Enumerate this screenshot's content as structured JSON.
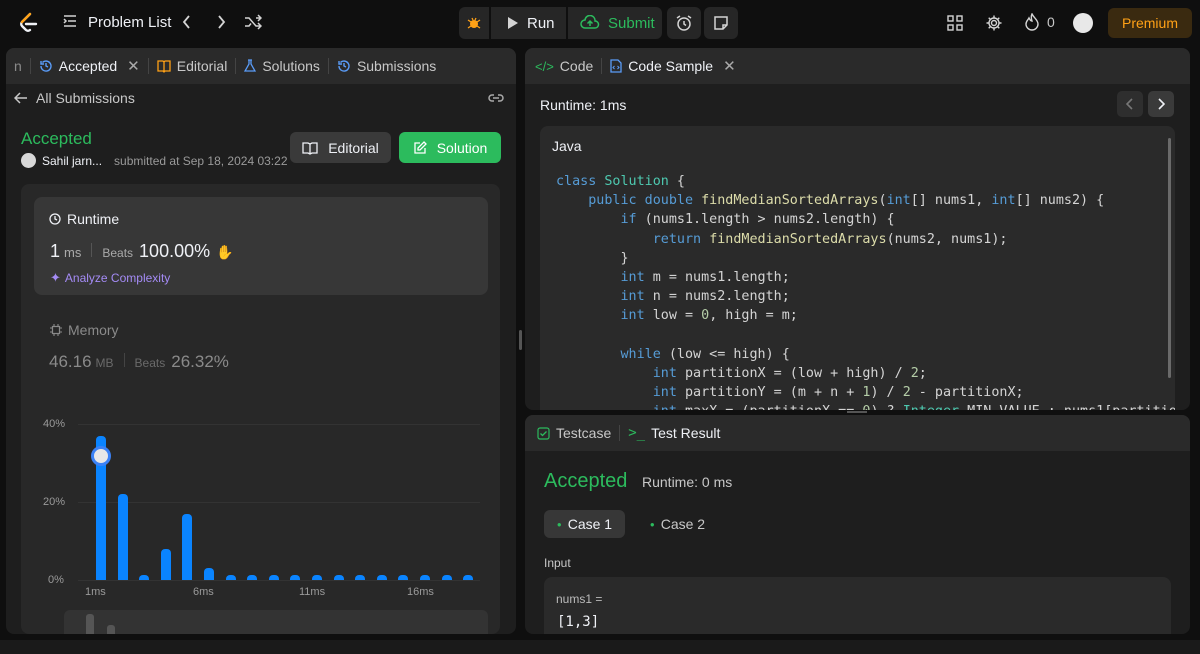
{
  "topbar": {
    "problem_list": "Problem List",
    "run": "Run",
    "submit": "Submit",
    "streak_count": "0",
    "premium": "Premium"
  },
  "left": {
    "tabs": [
      {
        "label": "n"
      },
      {
        "label": "Accepted"
      },
      {
        "label": "Editorial"
      },
      {
        "label": "Solutions"
      },
      {
        "label": "Submissions"
      }
    ],
    "all_submissions": "All Submissions",
    "status": "Accepted",
    "user": "Sahil jarn...",
    "submitted_at": "submitted at Sep 18, 2024 03:22",
    "editorial_btn": "Editorial",
    "solution_btn": "Solution",
    "runtime": {
      "title": "Runtime",
      "value": "1",
      "unit": "ms",
      "beats_label": "Beats",
      "beats": "100.00%",
      "analyze": "Analyze Complexity"
    },
    "memory": {
      "title": "Memory",
      "value": "46.16",
      "unit": "MB",
      "beats_label": "Beats",
      "beats": "26.32%"
    }
  },
  "chart_data": {
    "type": "bar",
    "y_ticks": [
      "40%",
      "20%",
      "0%"
    ],
    "x_ticks": [
      "1ms",
      "6ms",
      "11ms",
      "16ms"
    ],
    "ylim": [
      0,
      40
    ],
    "values": [
      37,
      22,
      1,
      8,
      17,
      3,
      1,
      1,
      1,
      1,
      1,
      1,
      1,
      1,
      1,
      1,
      1,
      1
    ],
    "highlight_index": 0
  },
  "right_top": {
    "tabs": [
      {
        "label": "Code"
      },
      {
        "label": "Code Sample"
      }
    ],
    "runtime_label": "Runtime: 1ms",
    "language": "Java"
  },
  "right_bottom": {
    "tabs": [
      {
        "label": "Testcase"
      },
      {
        "label": "Test Result"
      }
    ],
    "status": "Accepted",
    "runtime": "Runtime: 0 ms",
    "cases": [
      {
        "label": "Case 1"
      },
      {
        "label": "Case 2"
      }
    ],
    "input_label": "Input",
    "param_name": "nums1 =",
    "param_value": "[1,3]"
  },
  "colors": {
    "accent_green": "#2cbb5d",
    "bar_blue": "#0a84ff",
    "premium_orange": "#ffa116"
  }
}
